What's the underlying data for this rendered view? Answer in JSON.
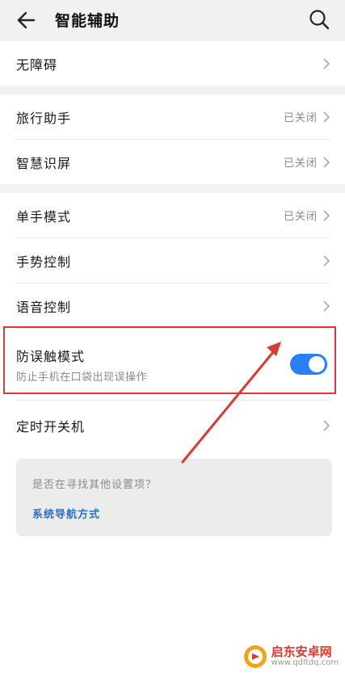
{
  "header": {
    "title": "智能辅助"
  },
  "sections": {
    "accessibility": {
      "label": "无障碍"
    },
    "travel_assistant": {
      "label": "旅行助手",
      "status": "已关闭"
    },
    "smart_screen": {
      "label": "智慧识屏",
      "status": "已关闭"
    },
    "one_hand_mode": {
      "label": "单手模式",
      "status": "已关闭"
    },
    "gesture_control": {
      "label": "手势控制"
    },
    "voice_control": {
      "label": "语音控制"
    },
    "accidental_touch": {
      "label": "防误触模式",
      "subtitle": "防止手机在口袋出现误操作",
      "enabled": true
    },
    "scheduled_power": {
      "label": "定时开关机"
    }
  },
  "suggestion": {
    "question": "是否在寻找其他设置项？",
    "link": "系统导航方式"
  },
  "watermark": {
    "brand": "启东安卓网",
    "url": "www.qdltdq.com"
  },
  "colors": {
    "accent": "#2a7ff4",
    "link": "#2a6fc9",
    "highlight": "#d93a34"
  }
}
